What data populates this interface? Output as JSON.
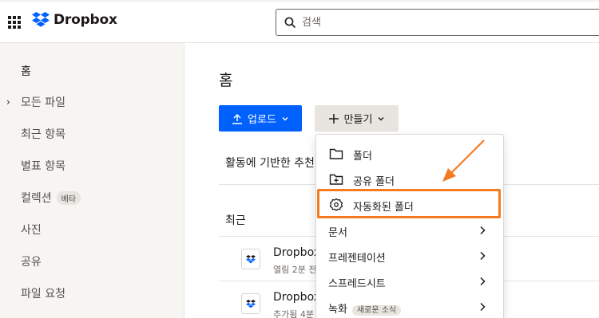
{
  "header": {
    "brand": "Dropbox",
    "search_placeholder": "검색"
  },
  "sidebar": {
    "items": [
      {
        "label": "홈"
      },
      {
        "label": "모든 파일"
      },
      {
        "label": "최근 항목"
      },
      {
        "label": "별표 항목"
      },
      {
        "label": "컬렉션",
        "badge": "베타"
      },
      {
        "label": "사진"
      },
      {
        "label": "공유"
      },
      {
        "label": "파일 요청"
      }
    ]
  },
  "main": {
    "title": "홈",
    "upload_label": "업로드",
    "create_label": "만들기",
    "activity_heading": "활동에 기반한 추천",
    "recent_heading": "최근",
    "files": [
      {
        "name": "Dropbox",
        "meta": "열림 2분 전"
      },
      {
        "name": "Dropbox",
        "meta": "추가됨 4분"
      }
    ]
  },
  "create_menu": {
    "items": [
      {
        "label": "폴더",
        "icon": "folder-icon"
      },
      {
        "label": "공유 폴더",
        "icon": "shared-folder-icon"
      },
      {
        "label": "자동화된 폴더",
        "icon": "gear-icon"
      },
      {
        "label": "문서"
      },
      {
        "label": "프레젠테이션"
      },
      {
        "label": "스프레드시트"
      },
      {
        "label": "녹화",
        "badge": "새로운 소식"
      }
    ]
  },
  "colors": {
    "brand_blue": "#0061fe",
    "annotation_orange": "#f47b20",
    "sidebar_bg": "#f7f5f2"
  }
}
